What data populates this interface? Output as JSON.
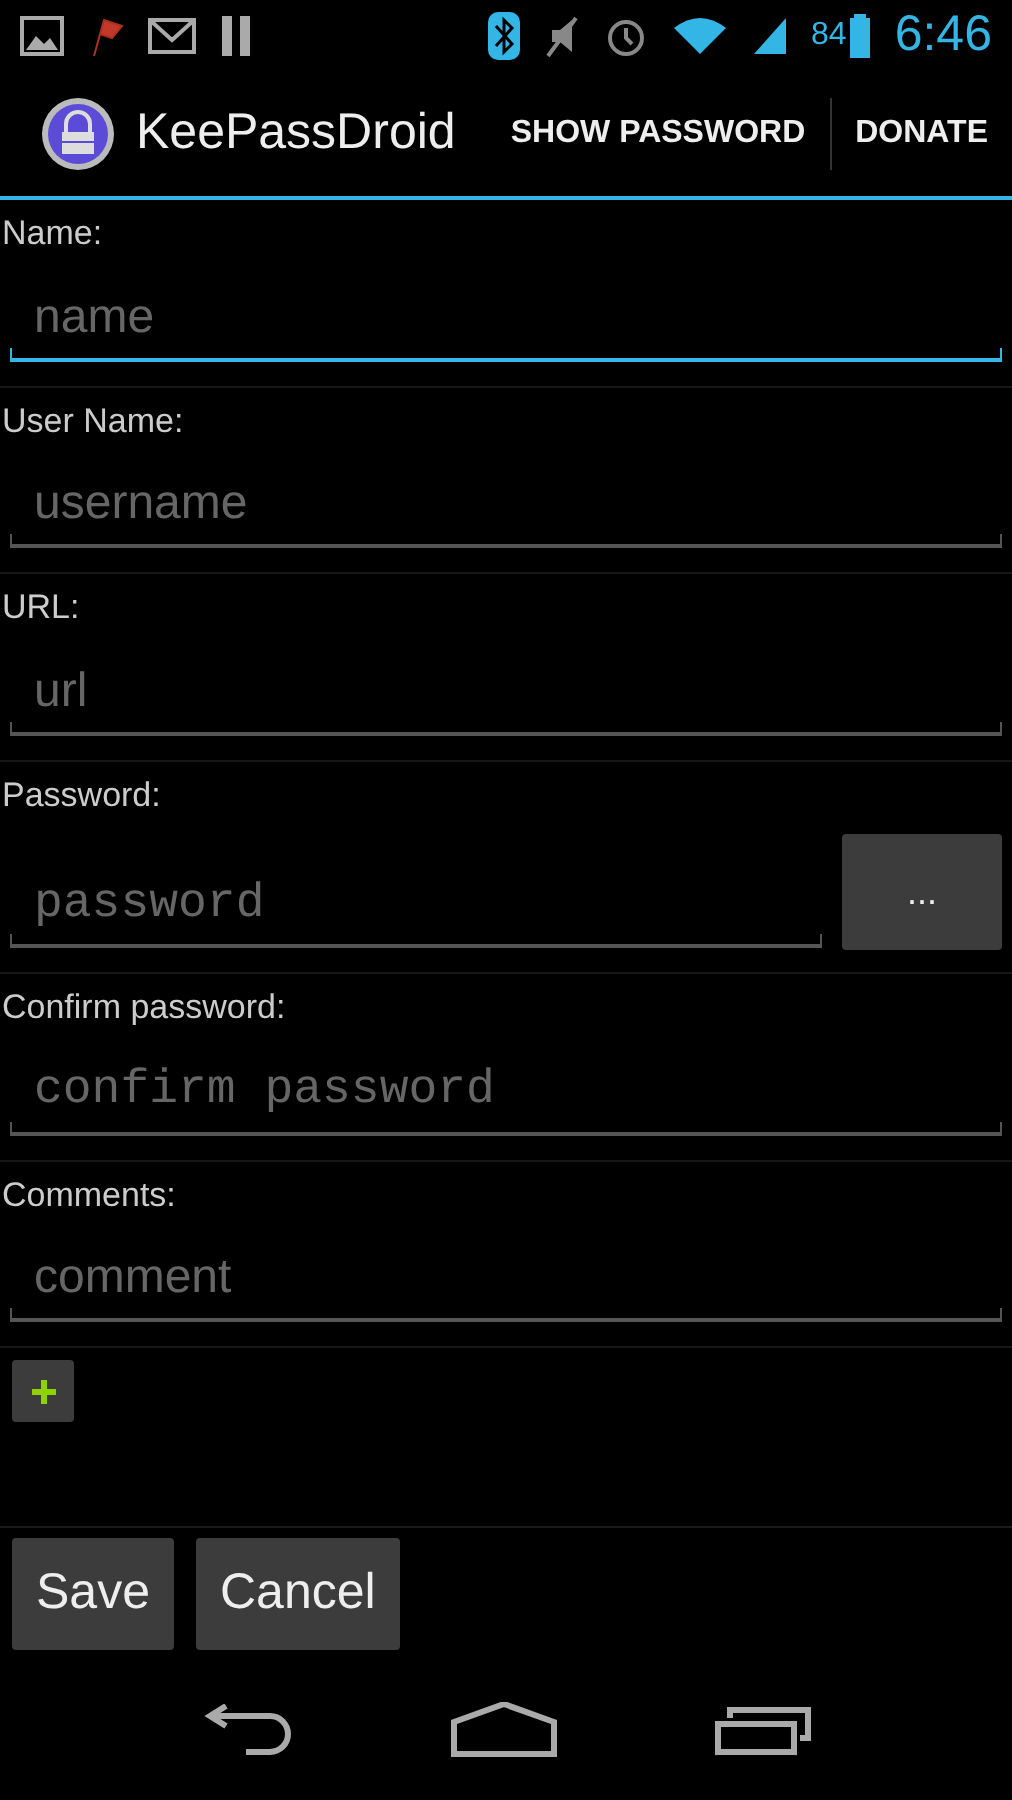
{
  "status_bar": {
    "battery": "84",
    "time": "6:46"
  },
  "action_bar": {
    "title": "KeePassDroid",
    "actions": [
      "SHOW PASSWORD",
      "DONATE"
    ]
  },
  "fields": [
    {
      "label": "Name:",
      "placeholder": "name",
      "kind": "text",
      "focused": true
    },
    {
      "label": "User Name:",
      "placeholder": "username",
      "kind": "text",
      "focused": false
    },
    {
      "label": "URL:",
      "placeholder": "url",
      "kind": "text",
      "focused": false
    },
    {
      "label": "Password:",
      "placeholder": "password",
      "kind": "password",
      "focused": false,
      "button": "..."
    },
    {
      "label": "Confirm password:",
      "placeholder": "confirm password",
      "kind": "password",
      "focused": false
    },
    {
      "label": "Comments:",
      "placeholder": "comment",
      "kind": "text",
      "focused": false
    }
  ],
  "buttons": [
    "Save",
    "Cancel"
  ]
}
